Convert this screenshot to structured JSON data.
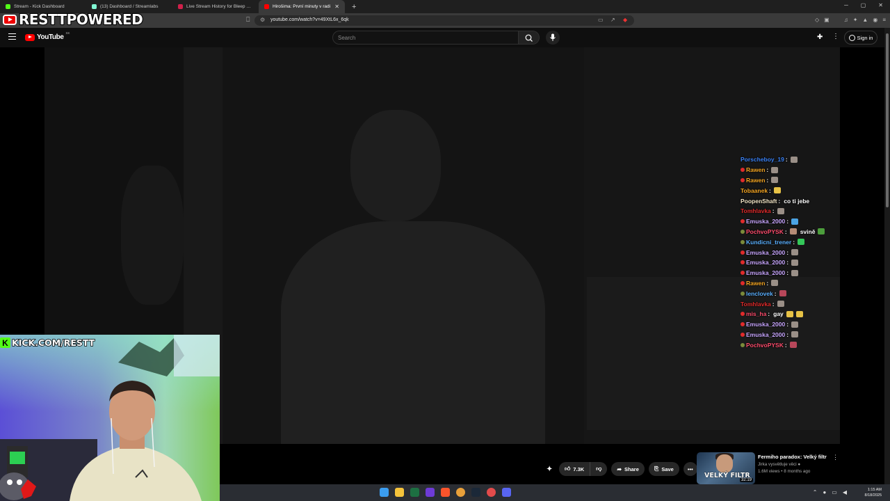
{
  "browser": {
    "tabs": [
      {
        "title": "Stream - Kick Dashboard",
        "favicon_color": "#53fc18",
        "active": false
      },
      {
        "title": "(13) Dashboard / Streamlabs",
        "favicon_color": "#80f5d2",
        "active": false
      },
      {
        "title": "Live Stream History for Bleep Shares",
        "favicon_color": "#d0204a",
        "active": false
      },
      {
        "title": "Hirošima: První minuty v radi",
        "favicon_color": "#ff0000",
        "active": true
      }
    ],
    "new_tab_symbol": "+",
    "url": "youtube.com/watch?v=49XtL6x_6qk"
  },
  "overlay": {
    "logo_text": "RESTTPOWERED",
    "kick_banner": "KICK.COM/RESTT",
    "kick_letter": "K"
  },
  "youtube": {
    "logo_word": "YouTube",
    "country_code": "SK",
    "search_placeholder": "Search",
    "sign_in": "Sign in"
  },
  "chat": [
    {
      "user": "Porscheboy_19",
      "color": "#3b82f6",
      "badge": "",
      "text": "",
      "emotes": [
        "#9a8f87"
      ]
    },
    {
      "user": "Rawen",
      "color": "#f5a623",
      "badge": "#e02b2b",
      "text": "",
      "emotes": [
        "#9a8f87"
      ]
    },
    {
      "user": "Rawen",
      "color": "#f5a623",
      "badge": "#e02b2b",
      "text": "",
      "emotes": [
        "#9a8f87"
      ]
    },
    {
      "user": "Tobaanek",
      "color": "#f5a623",
      "badge": "",
      "text": "",
      "emotes": [
        "#e7c246"
      ]
    },
    {
      "user": "PoopenShaft",
      "color": "#f4e7c8",
      "badge": "",
      "text": "co ti jebe",
      "emotes": []
    },
    {
      "user": "Tomhlavka",
      "color": "#e02b2b",
      "badge": "",
      "text": "",
      "emotes": [
        "#9a8f87"
      ]
    },
    {
      "user": "Emuska_2000",
      "color": "#c9a7ff",
      "badge": "#e02b2b",
      "text": "",
      "emotes": [
        "#4ba3e3"
      ]
    },
    {
      "user": "PochvoPYSK",
      "color": "#ff4d6d",
      "badge": "#7b8b3a",
      "text": "svině",
      "emotes": [
        "#b58c76",
        "#4c9e3c"
      ]
    },
    {
      "user": "Kundicni_trener",
      "color": "#5bb0ff",
      "badge": "#7b8b3a",
      "text": "",
      "emotes": [
        "#34c759"
      ]
    },
    {
      "user": "Emuska_2000",
      "color": "#c9a7ff",
      "badge": "#e02b2b",
      "text": "",
      "emotes": [
        "#9a8f87"
      ]
    },
    {
      "user": "Emuska_2000",
      "color": "#c9a7ff",
      "badge": "#e02b2b",
      "text": "",
      "emotes": [
        "#9a8f87"
      ]
    },
    {
      "user": "Emuska_2000",
      "color": "#c9a7ff",
      "badge": "#e02b2b",
      "text": "",
      "emotes": [
        "#9a8f87"
      ]
    },
    {
      "user": "Rawen",
      "color": "#f5a623",
      "badge": "#e02b2b",
      "text": "",
      "emotes": [
        "#9a8f87"
      ]
    },
    {
      "user": "lenclovek",
      "color": "#5bb0ff",
      "badge": "#7b8b3a",
      "text": "",
      "emotes": [
        "#b8475a"
      ]
    },
    {
      "user": "Tomhlavka",
      "color": "#e02b2b",
      "badge": "",
      "text": "",
      "emotes": [
        "#9a8f87"
      ]
    },
    {
      "user": "mis_ha",
      "color": "#ff4d6d",
      "badge": "#e02b2b",
      "text": "gay",
      "emotes": [
        "#e7c246",
        "#e7c246"
      ]
    },
    {
      "user": "Emuska_2000",
      "color": "#c9a7ff",
      "badge": "#e02b2b",
      "text": "",
      "emotes": [
        "#9a8f87"
      ]
    },
    {
      "user": "Emuska_2000",
      "color": "#c9a7ff",
      "badge": "#e02b2b",
      "text": "",
      "emotes": [
        "#9a8f87"
      ]
    },
    {
      "user": "PochvoPYSK",
      "color": "#ff4d6d",
      "badge": "#7b8b3a",
      "text": "",
      "emotes": [
        "#b8475a"
      ]
    }
  ],
  "actions": {
    "likes": "7.3K",
    "share": "Share",
    "save": "Save"
  },
  "recommended": {
    "title": "Fermiho paradox: Velký filtr",
    "channel": "Jirka vysvětluje věci",
    "meta": "1.6M views • 8 months ago",
    "thumb_text": "VELKÝ FILTR",
    "duration": "32:19"
  },
  "system": {
    "time": "1:15 AM",
    "date": "8/18/2025"
  }
}
